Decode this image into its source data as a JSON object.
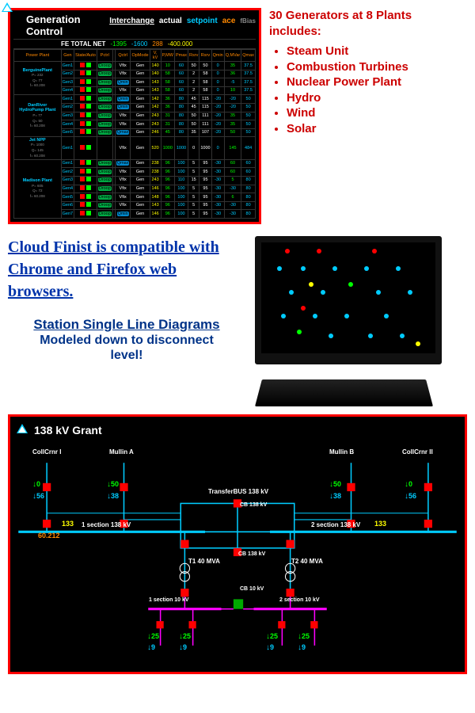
{
  "gen_panel": {
    "title": "Generation Control",
    "interchange": "Interchange",
    "actual": "actual",
    "setpoint": "setpoint",
    "ace": "ace",
    "fbias": "fBias",
    "fe_label": "FE TOTAL NET",
    "fe_actual": "-1395",
    "fe_setpoint": "-1600",
    "fe_ace": "288",
    "fe_fbias": "-400.000",
    "cols": [
      "Power Plant",
      "Gen",
      "State/Auto",
      "Pctrl",
      "",
      "Qctrl",
      "OpMode",
      "V, kV",
      "P,MW",
      "Pmax",
      "Rsrv",
      "Rsrv",
      "Qmin",
      "Q,MVar",
      "Qmax"
    ],
    "plants": [
      {
        "name": "BerguinePlant",
        "meta": [
          "P= 232",
          "Q= 77",
          "f= 60.208"
        ],
        "rows": [
          [
            "Gen1",
            "",
            "Droop",
            "",
            "Vfix",
            "Gen",
            "140",
            "10",
            "60",
            "50",
            "50",
            "0",
            "35",
            "37.5"
          ],
          [
            "Gen2",
            "",
            "Droop",
            "",
            "Vfix",
            "Gen",
            "140",
            "58",
            "60",
            "2",
            "58",
            "0",
            "36",
            "37.5"
          ],
          [
            "Gen3",
            "",
            "Droop",
            "",
            "Qmin",
            "Gen",
            "143",
            "58",
            "60",
            "2",
            "58",
            "0",
            "-5",
            "37.5"
          ],
          [
            "Gen4",
            "",
            "Droop",
            "",
            "Vfix",
            "Gen",
            "143",
            "58",
            "60",
            "2",
            "58",
            "0",
            "10",
            "37.5"
          ]
        ]
      },
      {
        "name": "DanRiver HydroPump Plant",
        "meta": [
          "P= 77",
          "Q= 50",
          "f= 60.208"
        ],
        "rows": [
          [
            "Gen1",
            "",
            "Droop",
            "",
            "Qmin",
            "Gen",
            "142",
            "36",
            "80",
            "45",
            "115",
            "-20",
            "-20",
            "50"
          ],
          [
            "Gen2",
            "",
            "Droop",
            "",
            "Qmin",
            "Gen",
            "142",
            "36",
            "80",
            "45",
            "115",
            "-20",
            "-20",
            "50"
          ],
          [
            "Gen3",
            "",
            "Droop",
            "",
            "Vfix",
            "Gen",
            "243",
            "31",
            "80",
            "50",
            "111",
            "-20",
            "35",
            "50"
          ],
          [
            "Gen4",
            "",
            "Droop",
            "",
            "Vfix",
            "Gen",
            "243",
            "31",
            "80",
            "50",
            "111",
            "-20",
            "35",
            "50"
          ],
          [
            "Gen5",
            "",
            "Droop",
            "",
            "Qmax",
            "Gen",
            "246",
            "45",
            "80",
            "35",
            "107",
            "-20",
            "50",
            "50"
          ]
        ]
      },
      {
        "name": "Jet NPP",
        "meta": [
          "P= 1000",
          "Q= 145",
          "f= 60.208"
        ],
        "rows": [
          [
            "Gen1",
            "",
            "",
            "",
            "Vfix",
            "Gen",
            "520",
            "1000",
            "1000",
            "0",
            "1000",
            "0",
            "145",
            "484"
          ]
        ]
      },
      {
        "name": "Madison Plant",
        "meta": [
          "P= 605",
          "Q= 72",
          "f= 60.208"
        ],
        "rows": [
          [
            "Gen1",
            "",
            "Droop",
            "",
            "Qmax",
            "Gen",
            "238",
            "96",
            "100",
            "5",
            "95",
            "-30",
            "60",
            "60"
          ],
          [
            "Gen2",
            "",
            "Droop",
            "",
            "Vfix",
            "Gen",
            "238",
            "96",
            "100",
            "5",
            "95",
            "-30",
            "60",
            "60"
          ],
          [
            "Gen3",
            "",
            "Droop",
            "",
            "Vfix",
            "Gen",
            "243",
            "96",
            "110",
            "15",
            "95",
            "-30",
            "5",
            "80"
          ],
          [
            "Gen4",
            "",
            "Droop",
            "",
            "Vfix",
            "Gen",
            "146",
            "96",
            "100",
            "5",
            "95",
            "-30",
            "-30",
            "80"
          ],
          [
            "Gen5",
            "",
            "Droop",
            "",
            "Vfix",
            "Gen",
            "148",
            "96",
            "100",
            "5",
            "95",
            "-30",
            "6",
            "80"
          ],
          [
            "Gen6",
            "",
            "Droop",
            "",
            "Vfix",
            "Gen",
            "143",
            "96",
            "100",
            "5",
            "95",
            "-30",
            "-30",
            "80"
          ],
          [
            "Gen7",
            "",
            "Droop",
            "",
            "Qmin",
            "Gen",
            "146",
            "96",
            "100",
            "5",
            "95",
            "-30",
            "-30",
            "80"
          ]
        ]
      }
    ]
  },
  "right": {
    "heading": "30 Generators at 8 Plants includes:",
    "items": [
      "Steam Unit",
      "Combustion Turbines",
      "Nuclear Power Plant",
      "Hydro",
      "Wind",
      "Solar"
    ]
  },
  "compat": "Cloud Finist is compatible with Chrome and Firefox web browsers.",
  "sld_h": "Station Single Line Diagrams",
  "sld_s1": "Modeled down to disconnect",
  "sld_s2": "level!",
  "sld": {
    "title": "138 kV Grant",
    "feeders": {
      "collcrnr1": {
        "name": "CollCrnr I",
        "top": "0",
        "bot": "56"
      },
      "mullina": {
        "name": "Mullin A",
        "top": "50",
        "bot": "38"
      },
      "mullinb": {
        "name": "Mullin B",
        "top": "50",
        "bot": "38"
      },
      "collcrnr2": {
        "name": "CollCrnr II",
        "top": "0",
        "bot": "56"
      }
    },
    "bus_left_v": "133",
    "bus_left_lbl": "1 section 138 kV",
    "bus_left_f": "60.212",
    "bus_right_v": "133",
    "bus_right_lbl": "2 section 138 kV",
    "xfer": "TransferBUS 138 kV",
    "cb138a": "CB 138 kV",
    "cb138b": "CB 138 kV",
    "t1": "T1 40 MVA",
    "t2": "T2 40 MVA",
    "cb10": "CB 10 kV",
    "sec10_1": "1 section 10 kV",
    "sec10_2": "2 section 10 kV",
    "low_vals": {
      "a": "25",
      "b": "9",
      "c": "25",
      "d": "9",
      "e": "25",
      "f": "9",
      "g": "25",
      "h": "9"
    }
  }
}
